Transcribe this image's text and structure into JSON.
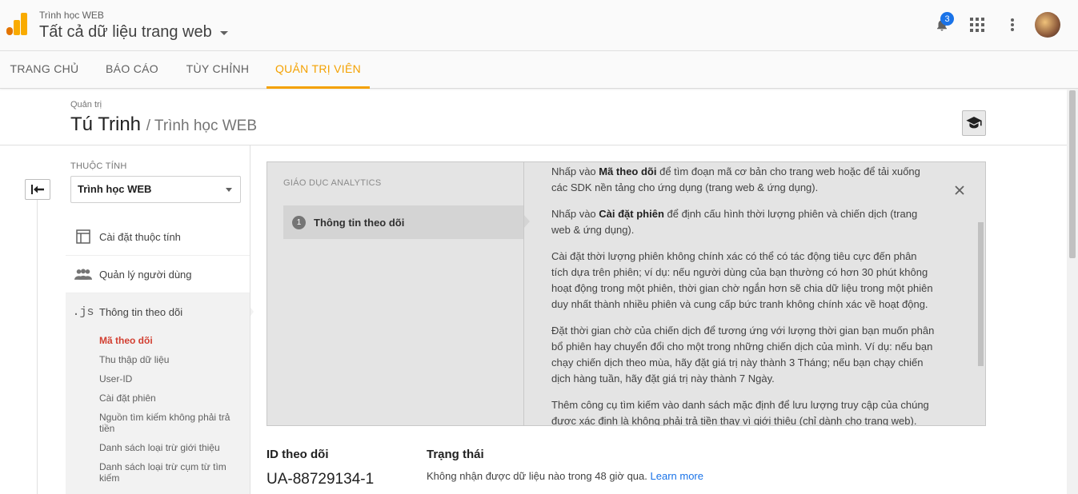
{
  "header": {
    "account_small": "Trình học WEB",
    "account_view": "Tất cả dữ liệu trang web",
    "notification_count": "3",
    "brand_colors": {
      "logo_dark": "#e37400",
      "logo_light": "#f9ab00"
    },
    "icons": [
      "bell-icon",
      "apps-grid-icon",
      "more-vert-icon",
      "avatar"
    ]
  },
  "nav": {
    "tabs": [
      {
        "label": "TRANG CHỦ"
      },
      {
        "label": "BÁO CÁO"
      },
      {
        "label": "TÙY CHỈNH"
      },
      {
        "label": "QUẢN TRỊ VIÊN"
      }
    ],
    "accent_color": "#f4a100"
  },
  "breadcrumb": {
    "small": "Quản trị",
    "title": "Tú Trinh",
    "subtitle": "/ Trình học WEB"
  },
  "property": {
    "label": "THUỘC TÍNH",
    "selected": "Trình học WEB"
  },
  "menu": {
    "items": [
      {
        "label": "Cài đặt thuộc tính",
        "icon": "property-settings-icon"
      },
      {
        "label": "Quản lý người dùng",
        "icon": "users-icon"
      },
      {
        "label": "Thông tin theo dõi",
        "icon": ".js"
      }
    ],
    "subitems": [
      {
        "label": "Mã theo dõi"
      },
      {
        "label": "Thu thập dữ liệu"
      },
      {
        "label": "User-ID"
      },
      {
        "label": "Cài đặt phiên"
      },
      {
        "label": "Nguồn tìm kiếm không phải trả tiền"
      },
      {
        "label": "Danh sách loại trừ giới thiệu"
      },
      {
        "label": "Danh sách loại trừ cụm từ tìm kiếm"
      }
    ],
    "current_color": "#d23f31"
  },
  "education": {
    "title": "GIÁO DỤC ANALYTICS",
    "step_number": "1",
    "step_label": "Thông tin theo dõi",
    "paragraphs": [
      {
        "pre": "Nhấp vào ",
        "bold": "Mã theo dõi",
        "post": " để tìm đoạn mã cơ bản cho trang web hoặc để tải xuống các SDK nền tảng cho ứng dụng (trang web & ứng dụng)."
      },
      {
        "pre": "Nhấp vào ",
        "bold": "Cài đặt phiên",
        "post": " để định cấu hình thời lượng phiên và chiến dịch (trang web & ứng dụng)."
      },
      {
        "pre": "Cài đặt thời lượng phiên không chính xác có thể có tác động tiêu cực đến phân tích dựa trên phiên; ví dụ: nếu người dùng của bạn thường có hơn 30 phút không hoạt động trong một phiên, thời gian chờ ngắn hơn sẽ chia dữ liệu trong một phiên duy nhất thành nhiều phiên và cung cấp bức tranh không chính xác về hoạt động.",
        "bold": "",
        "post": ""
      },
      {
        "pre": "Đặt thời gian chờ của chiến dịch để tương ứng với lượng thời gian bạn muốn phân bổ phiên hay chuyển đổi cho một trong những chiến dịch của mình. Ví dụ: nếu bạn chạy chiến dịch theo mùa, hãy đặt giá trị này thành 3 Tháng; nếu bạn chạy chiến dịch hàng tuần, hãy đặt giá trị này thành 7 Ngày.",
        "bold": "",
        "post": ""
      },
      {
        "pre": "Thêm công cụ tìm kiếm vào danh sách mặc định để lưu lượng truy cập của chúng được xác định là không phải trả tiền thay vì giới thiệu (chỉ dành cho trang web).",
        "bold": "",
        "post": ""
      }
    ]
  },
  "tracking": {
    "id_label": "ID theo dõi",
    "id_value": "UA-88729134-1",
    "status_label": "Trạng thái",
    "status_text": "Không nhận được dữ liệu nào trong 48 giờ qua.",
    "learn_more": "Learn more",
    "link_color": "#1a73e8"
  }
}
